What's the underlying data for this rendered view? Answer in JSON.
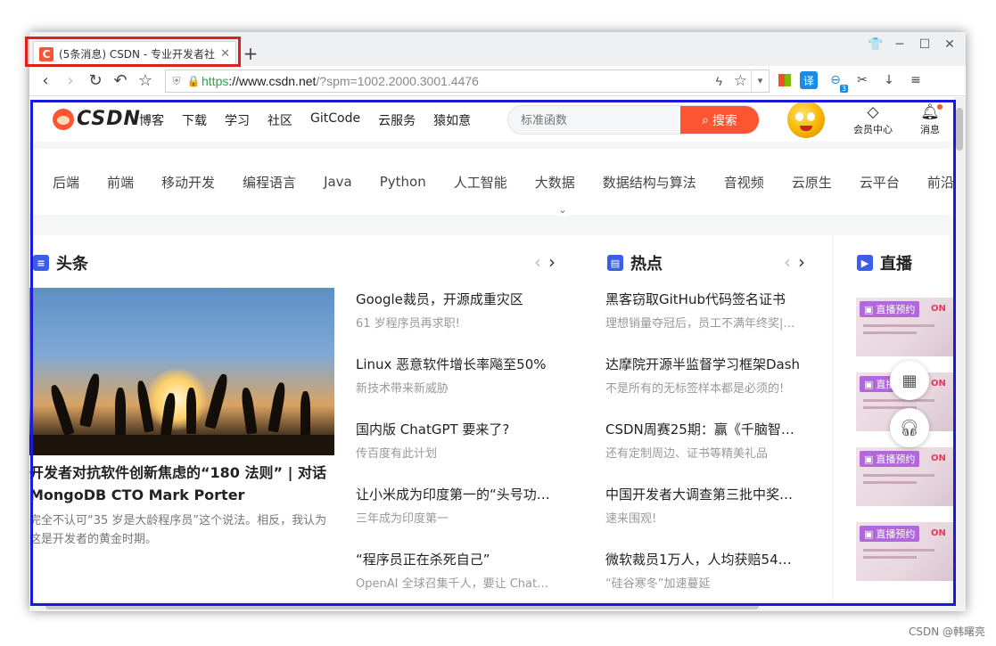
{
  "browser": {
    "tab_title": "(5条消息) CSDN - 专业开发者社",
    "tab_favicon": "C",
    "url_protocol": "https",
    "url_host": "://www.csdn.net",
    "url_path": "/?spm=1002.2000.3001.4476",
    "tools_badge": "3",
    "translate_label": "译"
  },
  "site": {
    "logo_text": "CSDN",
    "nav": [
      "博客",
      "下载",
      "学习",
      "社区",
      "GitCode",
      "云服务",
      "猿如意"
    ],
    "search_placeholder": "标准函数",
    "search_button": "搜索",
    "vip_label": "会员中心",
    "msg_label": "消息"
  },
  "categories": [
    "后端",
    "前端",
    "移动开发",
    "编程语言",
    "Java",
    "Python",
    "人工智能",
    "大数据",
    "数据结构与算法",
    "音视频",
    "云原生",
    "云平台",
    "前沿"
  ],
  "headline": {
    "section_title": "头条",
    "hero_title": "开发者对抗软件创新焦虑的“180 法则” | 对话 MongoDB CTO Mark Porter",
    "hero_desc": "完全不认可“35 岁是大龄程序员”这个说法。相反，我认为这是开发者的黄金时期。",
    "items": [
      {
        "title": "Google裁员，开源成重灾区",
        "desc": "61 岁程序员再求职!"
      },
      {
        "title": "Linux 恶意软件增长率飚至50%",
        "desc": "新技术带来新威胁"
      },
      {
        "title": "国内版 ChatGPT 要来了?",
        "desc": "传百度有此计划"
      },
      {
        "title": "让小米成为印度第一的“头号功…",
        "desc": "三年成为印度第一"
      },
      {
        "title": "“程序员正在杀死自己”",
        "desc": "OpenAI 全球召集千人，要让 Chat…"
      }
    ]
  },
  "hot": {
    "section_title": "热点",
    "items": [
      {
        "title": "黑客窃取GitHub代码签名证书",
        "desc": "理想销量夺冠后，员工不满年终奖|…"
      },
      {
        "title": "达摩院开源半监督学习框架Dash",
        "desc": "不是所有的无标签样本都是必须的!"
      },
      {
        "title": "CSDN周赛25期：赢《千脑智…",
        "desc": "还有定制周边、证书等精美礼品"
      },
      {
        "title": "中国开发者大调查第三批中奖…",
        "desc": "速来围观!"
      },
      {
        "title": "微软裁员1万人，人均获赔54…",
        "desc": "“硅谷寒冬”加速蔓延"
      }
    ]
  },
  "live": {
    "section_title": "直播",
    "card_badge": "直播预约",
    "card_on": "ON"
  },
  "watermark": "CSDN @韩曙亮",
  "colors": {
    "accent": "#fc5531",
    "highlight_red": "#e0201b",
    "highlight_blue": "#1a1adb"
  }
}
